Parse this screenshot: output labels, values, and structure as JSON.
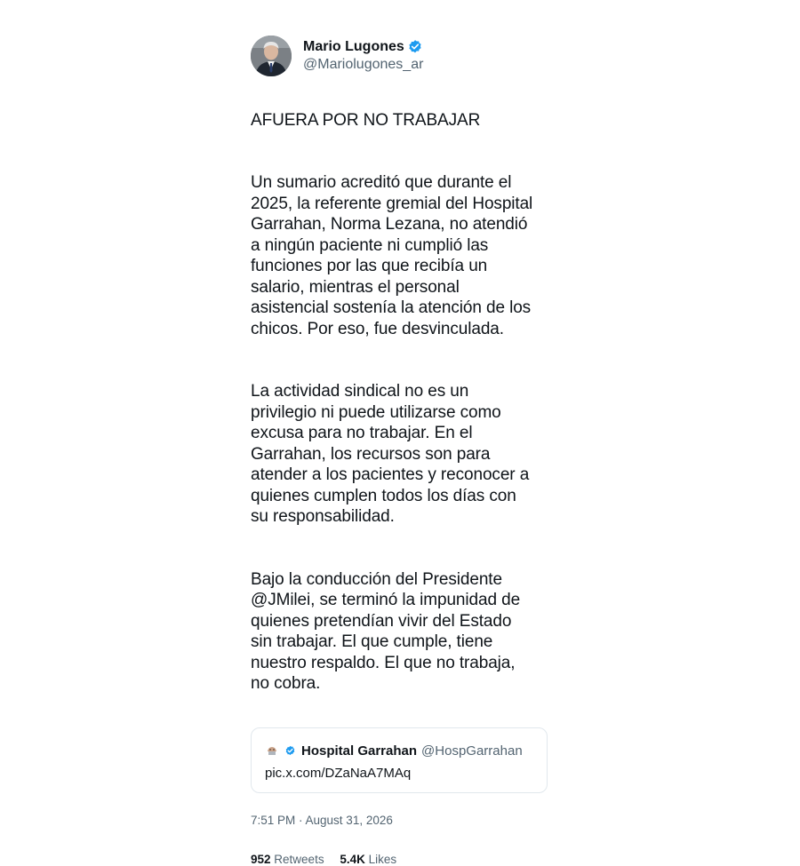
{
  "author": {
    "name": "Mario Lugones",
    "handle": "@Mariolugones_ar",
    "avatar_icon": "avatar-photo",
    "verified_color": "#1d9bf0"
  },
  "tweet": {
    "paragraphs": [
      "AFUERA POR NO TRABAJAR",
      "Un sumario acreditó que durante el\n2025, la referente gremial del Hospital\nGarrahan, Norma Lezana, no atendió\na ningún paciente ni cumplió las\nfunciones por las que recibía un\nsalario, mientras el personal\nasistencial sostenía la atención de los\nchicos. Por eso, fue desvinculada.",
      "La actividad sindical no es un\nprivilegio ni puede utilizarse como\nexcusa para no trabajar. En el\nGarrahan, los recursos son para\natender a los pacientes y reconocer a\nquienes cumplen todos los días con\nsu responsabilidad.",
      "Bajo la conducción del Presidente\n@JMilei, se terminó la impunidad de\nquienes pretendían vivir del Estado\nsin trabajar. El que cumple, tiene\nnuestro respaldo. El que no trabaja,\nno cobra."
    ]
  },
  "quote": {
    "name": "Hospital Garrahan",
    "handle": "@HospGarrahan",
    "link": "pic.x.com/DZaNaA7MAq",
    "logo_icon": "hospital-logo-icon"
  },
  "meta": {
    "timestamp": "7:51 PM · August 31, 2026"
  },
  "stats": {
    "retweets_count": "952",
    "retweets_label": "Retweets",
    "likes_count": "5.4K",
    "likes_label": "Likes"
  }
}
